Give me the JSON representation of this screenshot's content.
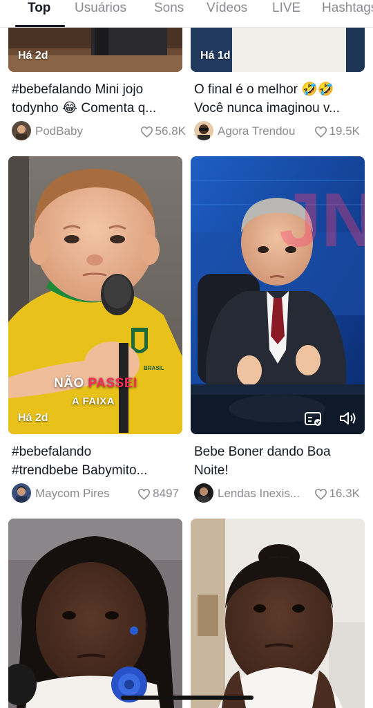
{
  "tabs": [
    {
      "label": "Top"
    },
    {
      "label": "Usuários"
    },
    {
      "label": "Sons"
    },
    {
      "label": "Vídeos"
    },
    {
      "label": "LIVE"
    },
    {
      "label": "Hashtags"
    }
  ],
  "cards": [
    {
      "badge": "Há 2d",
      "title_line1": "#bebefalando Mini jojo",
      "title_line2": "todynho 😂 Comenta q...",
      "author": "PodBaby",
      "likes": "56.8K"
    },
    {
      "badge": "Há 1d",
      "title_line1": "O final é o melhor 🤣🤣",
      "title_line2": "Você nunca imaginou v...",
      "author": "Agora Trendou",
      "likes": "19.5K"
    },
    {
      "badge": "Há 2d",
      "overlay_line1_white": "NÃO",
      "overlay_line1_red": "PASSEI",
      "overlay_line2": "A FAIXA",
      "jersey_text": "BRASIL",
      "title_line1": "#bebefalando",
      "title_line2": "#trendbebe Babymito...",
      "author": "Maycom Pires",
      "likes": "8497"
    },
    {
      "title_line1": "Bebe Boner dando Boa",
      "title_line2": "Noite!",
      "author": "Lendas Inexis...",
      "likes": "16.3K",
      "logo_text": "JN"
    },
    {},
    {}
  ],
  "colors": {
    "accent_red": "#fe2c55",
    "text": "#161823",
    "secondary": "#8a8b91"
  }
}
